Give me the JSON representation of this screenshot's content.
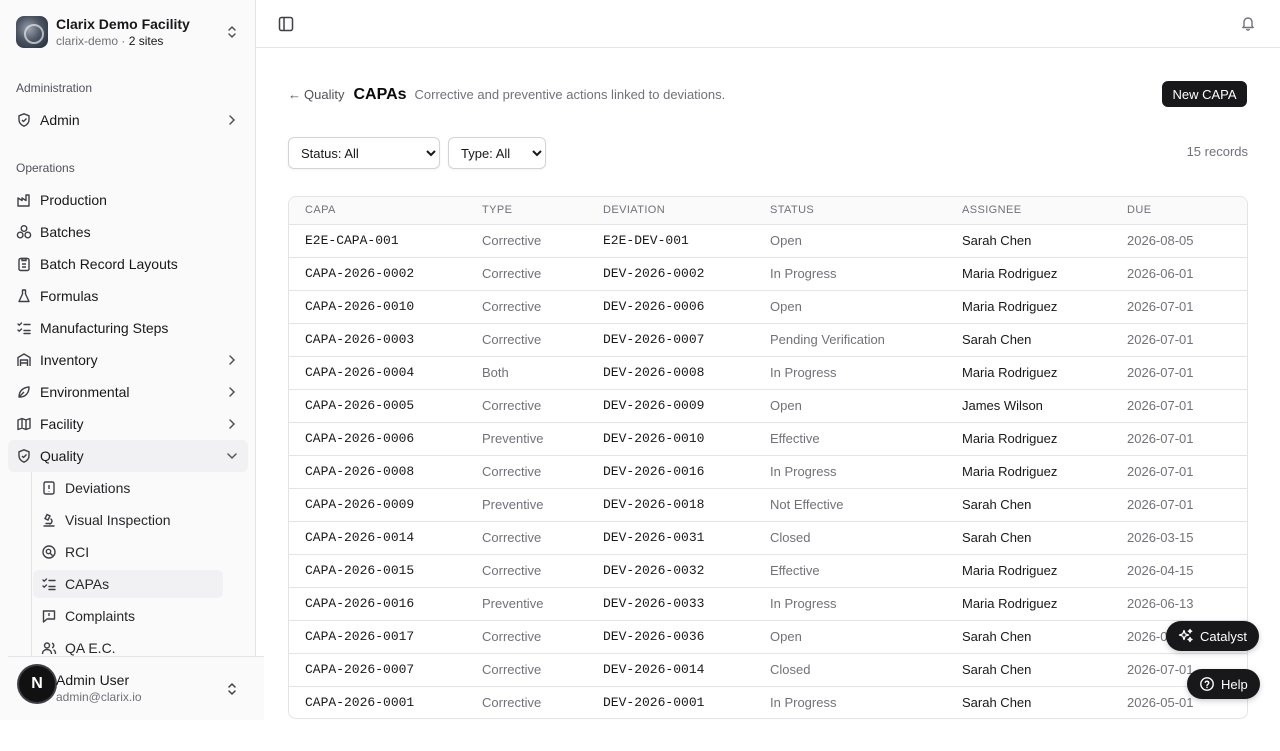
{
  "org": {
    "name": "Clarix Demo Facility",
    "slug": "clarix-demo",
    "sites": "2 sites",
    "sep": " · "
  },
  "sidebar": {
    "groups": {
      "administration": "Administration",
      "operations": "Operations"
    },
    "admin": "Admin",
    "items": {
      "production": "Production",
      "batches": "Batches",
      "batch_record_layouts": "Batch Record Layouts",
      "formulas": "Formulas",
      "manufacturing_steps": "Manufacturing Steps",
      "inventory": "Inventory",
      "environmental": "Environmental",
      "facility": "Facility",
      "quality": "Quality"
    },
    "quality_sub": {
      "deviations": "Deviations",
      "visual_inspection": "Visual Inspection",
      "rci": "RCI",
      "capas": "CAPAs",
      "complaints": "Complaints",
      "qa_ec": "QA E.C."
    }
  },
  "user": {
    "initial": "N",
    "name": "Admin User",
    "email": "admin@clarix.io"
  },
  "page": {
    "back": "Quality",
    "title": "CAPAs",
    "description": "Corrective and preventive actions linked to deviations.",
    "new_button": "New CAPA",
    "filters": {
      "status": "Status: All",
      "type": "Type: All"
    },
    "record_count": "15 records"
  },
  "table": {
    "headers": {
      "capa": "CAPA",
      "type": "TYPE",
      "deviation": "DEVIATION",
      "status": "STATUS",
      "assignee": "ASSIGNEE",
      "due": "DUE"
    },
    "rows": [
      {
        "capa": "E2E-CAPA-001",
        "type": "Corrective",
        "deviation": "E2E-DEV-001",
        "status": "Open",
        "assignee": "Sarah Chen",
        "due": "2026-08-05"
      },
      {
        "capa": "CAPA-2026-0002",
        "type": "Corrective",
        "deviation": "DEV-2026-0002",
        "status": "In Progress",
        "assignee": "Maria Rodriguez",
        "due": "2026-06-01"
      },
      {
        "capa": "CAPA-2026-0010",
        "type": "Corrective",
        "deviation": "DEV-2026-0006",
        "status": "Open",
        "assignee": "Maria Rodriguez",
        "due": "2026-07-01"
      },
      {
        "capa": "CAPA-2026-0003",
        "type": "Corrective",
        "deviation": "DEV-2026-0007",
        "status": "Pending Verification",
        "assignee": "Sarah Chen",
        "due": "2026-07-01"
      },
      {
        "capa": "CAPA-2026-0004",
        "type": "Both",
        "deviation": "DEV-2026-0008",
        "status": "In Progress",
        "assignee": "Maria Rodriguez",
        "due": "2026-07-01"
      },
      {
        "capa": "CAPA-2026-0005",
        "type": "Corrective",
        "deviation": "DEV-2026-0009",
        "status": "Open",
        "assignee": "James Wilson",
        "due": "2026-07-01"
      },
      {
        "capa": "CAPA-2026-0006",
        "type": "Preventive",
        "deviation": "DEV-2026-0010",
        "status": "Effective",
        "assignee": "Maria Rodriguez",
        "due": "2026-07-01"
      },
      {
        "capa": "CAPA-2026-0008",
        "type": "Corrective",
        "deviation": "DEV-2026-0016",
        "status": "In Progress",
        "assignee": "Maria Rodriguez",
        "due": "2026-07-01"
      },
      {
        "capa": "CAPA-2026-0009",
        "type": "Preventive",
        "deviation": "DEV-2026-0018",
        "status": "Not Effective",
        "assignee": "Sarah Chen",
        "due": "2026-07-01"
      },
      {
        "capa": "CAPA-2026-0014",
        "type": "Corrective",
        "deviation": "DEV-2026-0031",
        "status": "Closed",
        "assignee": "Sarah Chen",
        "due": "2026-03-15"
      },
      {
        "capa": "CAPA-2026-0015",
        "type": "Corrective",
        "deviation": "DEV-2026-0032",
        "status": "Effective",
        "assignee": "Maria Rodriguez",
        "due": "2026-04-15"
      },
      {
        "capa": "CAPA-2026-0016",
        "type": "Preventive",
        "deviation": "DEV-2026-0033",
        "status": "In Progress",
        "assignee": "Maria Rodriguez",
        "due": "2026-06-13"
      },
      {
        "capa": "CAPA-2026-0017",
        "type": "Corrective",
        "deviation": "DEV-2026-0036",
        "status": "Open",
        "assignee": "Sarah Chen",
        "due": "2026-06-01"
      },
      {
        "capa": "CAPA-2026-0007",
        "type": "Corrective",
        "deviation": "DEV-2026-0014",
        "status": "Closed",
        "assignee": "Sarah Chen",
        "due": "2026-07-01"
      },
      {
        "capa": "CAPA-2026-0001",
        "type": "Corrective",
        "deviation": "DEV-2026-0001",
        "status": "In Progress",
        "assignee": "Sarah Chen",
        "due": "2026-05-01"
      }
    ]
  },
  "floating": {
    "catalyst": "Catalyst",
    "help": "Help"
  },
  "icons": {
    "sidebar_toggle": "panel-left-icon",
    "notifications": "bell-icon",
    "catalyst": "sparkles-icon",
    "help": "help-circle-icon"
  }
}
